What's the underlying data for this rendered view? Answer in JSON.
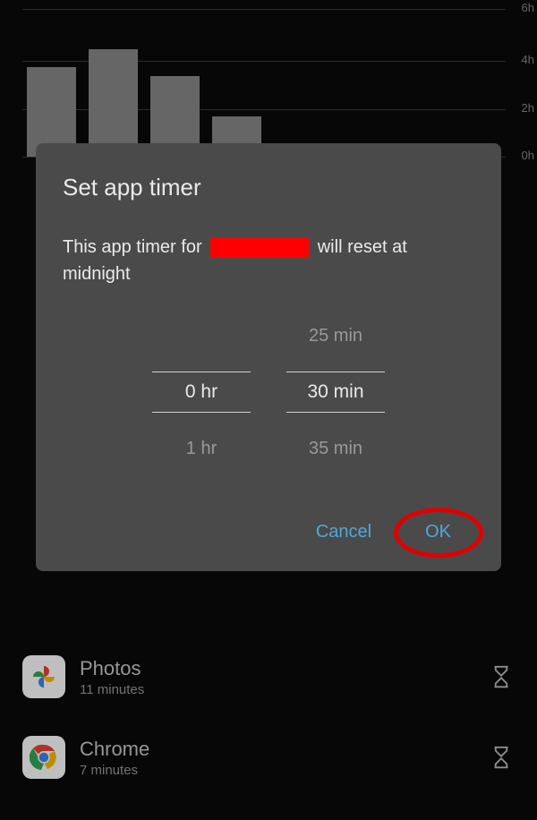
{
  "chart": {
    "gridlines": [
      "6h",
      "4h",
      "2h",
      "0h"
    ],
    "bars": [
      100,
      120,
      90,
      45
    ]
  },
  "modal": {
    "title": "Set app timer",
    "desc_prefix": "This app timer for",
    "desc_suffix": "will reset at midnight",
    "hour_values": [
      "",
      "0 hr",
      "1 hr"
    ],
    "min_values": [
      "25 min",
      "30 min",
      "35 min"
    ],
    "cancel": "Cancel",
    "ok": "OK"
  },
  "apps": [
    {
      "name": "Photos",
      "duration": "11 minutes"
    },
    {
      "name": "Chrome",
      "duration": "7 minutes"
    }
  ]
}
